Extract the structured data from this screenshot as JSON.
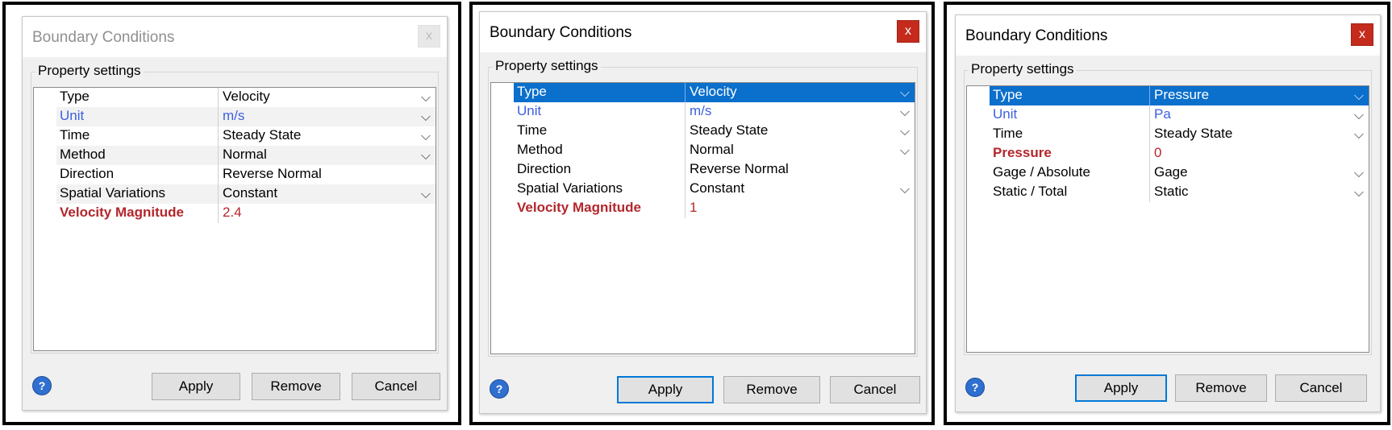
{
  "dialogs": [
    {
      "title": "Boundary Conditions",
      "close_label": "x",
      "group_label": "Property settings",
      "rows": [
        {
          "name": "Type",
          "value": "Velocity"
        },
        {
          "name": "Unit",
          "value": "m/s"
        },
        {
          "name": "Time",
          "value": "Steady State"
        },
        {
          "name": "Method",
          "value": "Normal"
        },
        {
          "name": "Direction",
          "value": "Reverse Normal"
        },
        {
          "name": "Spatial Variations",
          "value": "Constant"
        },
        {
          "name": "Velocity Magnitude",
          "value": "2.4"
        }
      ],
      "buttons": {
        "apply": "Apply",
        "remove": "Remove",
        "cancel": "Cancel"
      },
      "help_label": "?"
    },
    {
      "title": "Boundary Conditions",
      "close_label": "x",
      "group_label": "Property settings",
      "rows": [
        {
          "name": "Type",
          "value": "Velocity"
        },
        {
          "name": "Unit",
          "value": "m/s"
        },
        {
          "name": "Time",
          "value": "Steady State"
        },
        {
          "name": "Method",
          "value": "Normal"
        },
        {
          "name": "Direction",
          "value": "Reverse Normal"
        },
        {
          "name": "Spatial Variations",
          "value": "Constant"
        },
        {
          "name": "Velocity Magnitude",
          "value": "1"
        }
      ],
      "buttons": {
        "apply": "Apply",
        "remove": "Remove",
        "cancel": "Cancel"
      },
      "help_label": "?"
    },
    {
      "title": "Boundary Conditions",
      "close_label": "x",
      "group_label": "Property settings",
      "rows": [
        {
          "name": "Type",
          "value": "Pressure"
        },
        {
          "name": "Unit",
          "value": "Pa"
        },
        {
          "name": "Time",
          "value": "Steady State"
        },
        {
          "name": "Pressure",
          "value": "0"
        },
        {
          "name": "Gage / Absolute",
          "value": "Gage"
        },
        {
          "name": "Static / Total",
          "value": "Static"
        }
      ],
      "buttons": {
        "apply": "Apply",
        "remove": "Remove",
        "cancel": "Cancel"
      },
      "help_label": "?"
    }
  ],
  "colors": {
    "selection": "#0b6fcc",
    "unit_text": "#3d5fe0",
    "required_text": "#b3262c",
    "close_button": "#c42b1c",
    "default_button_border": "#0078d7"
  },
  "icons": {
    "close": "close-icon",
    "help": "help-icon",
    "dropdown": "chevron-down-icon"
  }
}
